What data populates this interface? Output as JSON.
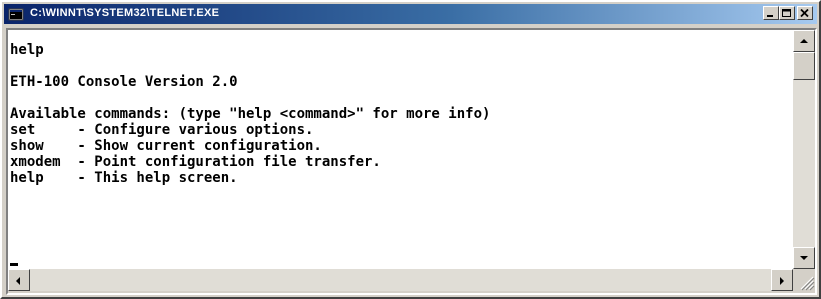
{
  "window": {
    "title": "C:\\WINNT\\SYSTEM32\\TELNET.EXE",
    "icon": "console-window-icon",
    "buttons": [
      "minimize-icon",
      "maximize-icon",
      "close-icon"
    ]
  },
  "console": {
    "lines": [
      "help",
      "",
      "ETH-100 Console Version 2.0",
      "",
      "Available commands: (type \"help <command>\" for more info)",
      "set     - Configure various options.",
      "show    - Show current configuration.",
      "xmodem  - Point configuration file transfer.",
      "help    - This help screen."
    ]
  },
  "scrollbars": {
    "vertical": {
      "up": "arrow-up-icon",
      "down": "arrow-down-icon"
    },
    "horizontal": {
      "left": "arrow-left-icon",
      "right": "arrow-right-icon"
    }
  },
  "colors": {
    "title_gradient_start": "#0a246a",
    "title_gradient_end": "#a6caf0",
    "console_bg": "#ffffff",
    "console_text": "#000000",
    "chrome": "#d4d0c8"
  }
}
